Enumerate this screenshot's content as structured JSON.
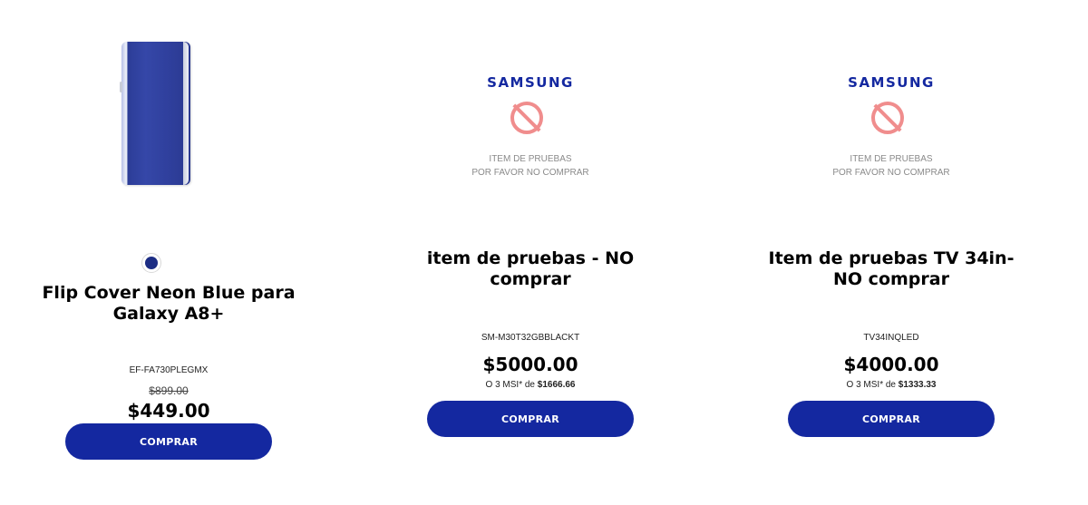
{
  "products": [
    {
      "title_line1": "Flip Cover Neon Blue para",
      "title_line2": "Galaxy A8+",
      "model": "EF-FA730PLEGMX",
      "old_price": "$899.00",
      "price": "$449.00",
      "buy_label": "COMPRAR",
      "swatch_color": "#1c2d84"
    },
    {
      "logo": "SAMSUNG",
      "placeholder_line1": "ITEM DE PRUEBAS",
      "placeholder_line2": "POR FAVOR NO COMPRAR",
      "title_line1": "item de pruebas - NO",
      "title_line2": "comprar",
      "model": "SM-M30T32GBBLACKT",
      "price": "$5000.00",
      "msi_prefix": "O 3 MSI* de",
      "msi_amount": "$1666.66",
      "buy_label": "COMPRAR"
    },
    {
      "logo": "SAMSUNG",
      "placeholder_line1": "ITEM DE PRUEBAS",
      "placeholder_line2": "POR FAVOR NO COMPRAR",
      "title_line1": "Item de pruebas TV 34in-",
      "title_line2": "NO comprar",
      "model": "TV34INQLED",
      "price": "$4000.00",
      "msi_prefix": "O 3 MSI* de",
      "msi_amount": "$1333.33",
      "buy_label": "COMPRAR"
    }
  ],
  "colors": {
    "brand": "#1428a0",
    "no_sign": "#f08d8d"
  }
}
